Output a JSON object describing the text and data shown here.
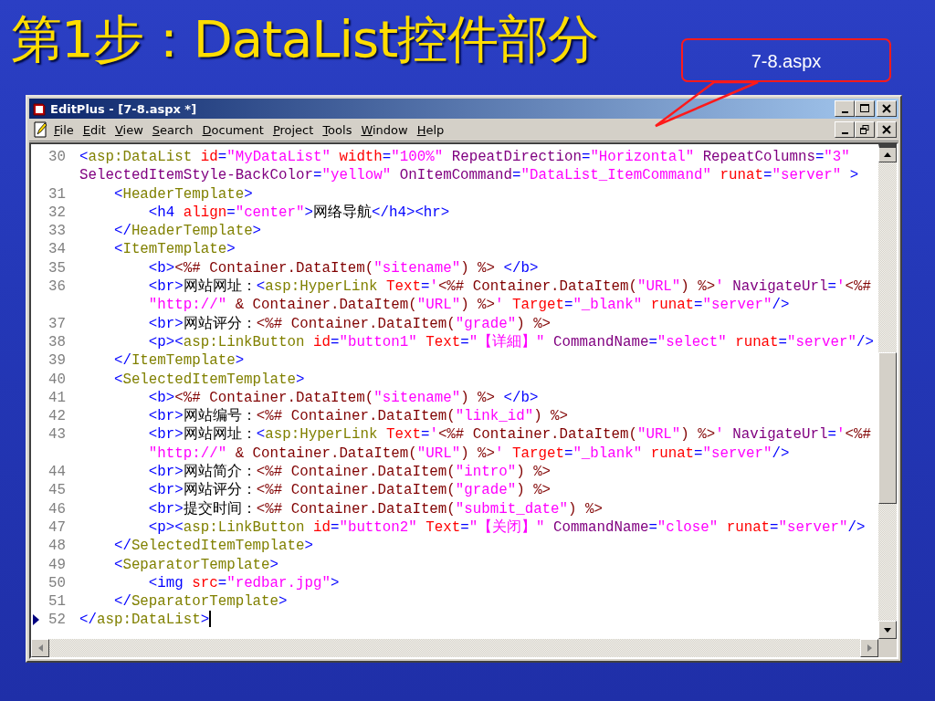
{
  "slide_title": "第1步：DataList控件部分",
  "callout": {
    "text": "7-8.aspx"
  },
  "editor": {
    "title": "EditPlus - [7-8.aspx *]",
    "menu": [
      "File",
      "Edit",
      "View",
      "Search",
      "Document",
      "Project",
      "Tools",
      "Window",
      "Help"
    ],
    "lines": [
      {
        "number": "30",
        "current": false,
        "segments": [
          {
            "kind": "bracket",
            "text": "<"
          },
          {
            "kind": "tag",
            "text": "asp:DataList"
          },
          {
            "kind": "attr",
            "text": " id"
          },
          {
            "kind": "bracket",
            "text": "="
          },
          {
            "kind": "string",
            "text": "\"MyDataList\""
          },
          {
            "kind": "attr",
            "text": " width"
          },
          {
            "kind": "bracket",
            "text": "="
          },
          {
            "kind": "string",
            "text": "\"100%\""
          },
          {
            "kind": "prop",
            "text": " RepeatDirection"
          },
          {
            "kind": "bracket",
            "text": "="
          },
          {
            "kind": "string",
            "text": "\"Horizontal\""
          },
          {
            "kind": "prop",
            "text": " RepeatColumns"
          },
          {
            "kind": "bracket",
            "text": "="
          },
          {
            "kind": "string",
            "text": "\"3\""
          }
        ]
      },
      {
        "current": false,
        "segments": [
          {
            "kind": "prop",
            "text": "SelectedItemStyle-BackColor"
          },
          {
            "kind": "bracket",
            "text": "="
          },
          {
            "kind": "string",
            "text": "\"yellow\""
          },
          {
            "kind": "prop",
            "text": " OnItemCommand"
          },
          {
            "kind": "bracket",
            "text": "="
          },
          {
            "kind": "string",
            "text": "\"DataList_ItemCommand\""
          },
          {
            "kind": "attr",
            "text": " runat"
          },
          {
            "kind": "bracket",
            "text": "="
          },
          {
            "kind": "string",
            "text": "\"server\""
          },
          {
            "kind": "bracket",
            "text": " >"
          }
        ]
      },
      {
        "number": "31",
        "current": false,
        "segments": [
          {
            "kind": "bracket",
            "text": "    <"
          },
          {
            "kind": "tag",
            "text": "HeaderTemplate"
          },
          {
            "kind": "bracket",
            "text": ">"
          }
        ]
      },
      {
        "number": "32",
        "current": false,
        "segments": [
          {
            "kind": "bracket",
            "text": "        <h4"
          },
          {
            "kind": "attr",
            "text": " align"
          },
          {
            "kind": "bracket",
            "text": "="
          },
          {
            "kind": "string",
            "text": "\"center\""
          },
          {
            "kind": "bracket",
            "text": ">"
          },
          {
            "kind": "text",
            "text": "网络导航"
          },
          {
            "kind": "bracket",
            "text": "</h4><hr>"
          }
        ]
      },
      {
        "number": "33",
        "current": false,
        "segments": [
          {
            "kind": "bracket",
            "text": "    </"
          },
          {
            "kind": "tag",
            "text": "HeaderTemplate"
          },
          {
            "kind": "bracket",
            "text": ">"
          }
        ]
      },
      {
        "number": "34",
        "current": false,
        "segments": [
          {
            "kind": "bracket",
            "text": "    <"
          },
          {
            "kind": "tag",
            "text": "ItemTemplate"
          },
          {
            "kind": "bracket",
            "text": ">"
          }
        ]
      },
      {
        "number": "35",
        "current": false,
        "segments": [
          {
            "kind": "bracket",
            "text": "        <b>"
          },
          {
            "kind": "script",
            "text": "<%# Container.DataItem("
          },
          {
            "kind": "string",
            "text": "\"sitename\""
          },
          {
            "kind": "script",
            "text": ") %>"
          },
          {
            "kind": "bracket",
            "text": " </b>"
          }
        ]
      },
      {
        "number": "36",
        "current": false,
        "segments": [
          {
            "kind": "bracket",
            "text": "        <br>"
          },
          {
            "kind": "text",
            "text": "网站网址："
          },
          {
            "kind": "bracket",
            "text": "<"
          },
          {
            "kind": "tag",
            "text": "asp:HyperLink"
          },
          {
            "kind": "attr",
            "text": " Text"
          },
          {
            "kind": "bracket",
            "text": "="
          },
          {
            "kind": "string",
            "text": "'"
          },
          {
            "kind": "script",
            "text": "<%# Container.DataItem("
          },
          {
            "kind": "string",
            "text": "\"URL\""
          },
          {
            "kind": "script",
            "text": ") %>"
          },
          {
            "kind": "string",
            "text": "'"
          },
          {
            "kind": "prop",
            "text": " NavigateUrl"
          },
          {
            "kind": "bracket",
            "text": "="
          },
          {
            "kind": "string",
            "text": "'"
          },
          {
            "kind": "script",
            "text": "<%#"
          }
        ]
      },
      {
        "current": false,
        "segments": [
          {
            "kind": "string",
            "text": "        \"http://\""
          },
          {
            "kind": "script",
            "text": " & Container.DataItem("
          },
          {
            "kind": "string",
            "text": "\"URL\""
          },
          {
            "kind": "script",
            "text": ") %>"
          },
          {
            "kind": "string",
            "text": "'"
          },
          {
            "kind": "attr",
            "text": " Target"
          },
          {
            "kind": "bracket",
            "text": "="
          },
          {
            "kind": "string",
            "text": "\"_blank\""
          },
          {
            "kind": "attr",
            "text": " runat"
          },
          {
            "kind": "bracket",
            "text": "="
          },
          {
            "kind": "string",
            "text": "\"server\""
          },
          {
            "kind": "bracket",
            "text": "/>"
          }
        ]
      },
      {
        "number": "37",
        "current": false,
        "segments": [
          {
            "kind": "bracket",
            "text": "        <br>"
          },
          {
            "kind": "text",
            "text": "网站评分："
          },
          {
            "kind": "script",
            "text": "<%# Container.DataItem("
          },
          {
            "kind": "string",
            "text": "\"grade\""
          },
          {
            "kind": "script",
            "text": ") %>"
          }
        ]
      },
      {
        "number": "38",
        "current": false,
        "segments": [
          {
            "kind": "bracket",
            "text": "        <p><"
          },
          {
            "kind": "tag",
            "text": "asp:LinkButton"
          },
          {
            "kind": "attr",
            "text": " id"
          },
          {
            "kind": "bracket",
            "text": "="
          },
          {
            "kind": "string",
            "text": "\"button1\""
          },
          {
            "kind": "attr",
            "text": " Text"
          },
          {
            "kind": "bracket",
            "text": "="
          },
          {
            "kind": "string",
            "text": "\"【详細】\""
          },
          {
            "kind": "prop",
            "text": " CommandName"
          },
          {
            "kind": "bracket",
            "text": "="
          },
          {
            "kind": "string",
            "text": "\"select\""
          },
          {
            "kind": "attr",
            "text": " runat"
          },
          {
            "kind": "bracket",
            "text": "="
          },
          {
            "kind": "string",
            "text": "\"server\""
          },
          {
            "kind": "bracket",
            "text": "/>"
          }
        ]
      },
      {
        "number": "39",
        "current": false,
        "segments": [
          {
            "kind": "bracket",
            "text": "    </"
          },
          {
            "kind": "tag",
            "text": "ItemTemplate"
          },
          {
            "kind": "bracket",
            "text": ">"
          }
        ]
      },
      {
        "number": "40",
        "current": false,
        "segments": [
          {
            "kind": "bracket",
            "text": "    <"
          },
          {
            "kind": "tag",
            "text": "SelectedItemTemplate"
          },
          {
            "kind": "bracket",
            "text": ">"
          }
        ]
      },
      {
        "number": "41",
        "current": false,
        "segments": [
          {
            "kind": "bracket",
            "text": "        <b>"
          },
          {
            "kind": "script",
            "text": "<%# Container.DataItem("
          },
          {
            "kind": "string",
            "text": "\"sitename\""
          },
          {
            "kind": "script",
            "text": ") %>"
          },
          {
            "kind": "bracket",
            "text": " </b>"
          }
        ]
      },
      {
        "number": "42",
        "current": false,
        "segments": [
          {
            "kind": "bracket",
            "text": "        <br>"
          },
          {
            "kind": "text",
            "text": "网站编号："
          },
          {
            "kind": "script",
            "text": "<%# Container.DataItem("
          },
          {
            "kind": "string",
            "text": "\"link_id\""
          },
          {
            "kind": "script",
            "text": ") %>"
          }
        ]
      },
      {
        "number": "43",
        "current": false,
        "segments": [
          {
            "kind": "bracket",
            "text": "        <br>"
          },
          {
            "kind": "text",
            "text": "网站网址："
          },
          {
            "kind": "bracket",
            "text": "<"
          },
          {
            "kind": "tag",
            "text": "asp:HyperLink"
          },
          {
            "kind": "attr",
            "text": " Text"
          },
          {
            "kind": "bracket",
            "text": "="
          },
          {
            "kind": "string",
            "text": "'"
          },
          {
            "kind": "script",
            "text": "<%# Container.DataItem("
          },
          {
            "kind": "string",
            "text": "\"URL\""
          },
          {
            "kind": "script",
            "text": ") %>"
          },
          {
            "kind": "string",
            "text": "'"
          },
          {
            "kind": "prop",
            "text": " NavigateUrl"
          },
          {
            "kind": "bracket",
            "text": "="
          },
          {
            "kind": "string",
            "text": "'"
          },
          {
            "kind": "script",
            "text": "<%#"
          }
        ]
      },
      {
        "current": false,
        "segments": [
          {
            "kind": "string",
            "text": "        \"http://\""
          },
          {
            "kind": "script",
            "text": " & Container.DataItem("
          },
          {
            "kind": "string",
            "text": "\"URL\""
          },
          {
            "kind": "script",
            "text": ") %>"
          },
          {
            "kind": "string",
            "text": "'"
          },
          {
            "kind": "attr",
            "text": " Target"
          },
          {
            "kind": "bracket",
            "text": "="
          },
          {
            "kind": "string",
            "text": "\"_blank\""
          },
          {
            "kind": "attr",
            "text": " runat"
          },
          {
            "kind": "bracket",
            "text": "="
          },
          {
            "kind": "string",
            "text": "\"server\""
          },
          {
            "kind": "bracket",
            "text": "/>"
          }
        ]
      },
      {
        "number": "44",
        "current": false,
        "segments": [
          {
            "kind": "bracket",
            "text": "        <br>"
          },
          {
            "kind": "text",
            "text": "网站简介："
          },
          {
            "kind": "script",
            "text": "<%# Container.DataItem("
          },
          {
            "kind": "string",
            "text": "\"intro\""
          },
          {
            "kind": "script",
            "text": ") %>"
          }
        ]
      },
      {
        "number": "45",
        "current": false,
        "segments": [
          {
            "kind": "bracket",
            "text": "        <br>"
          },
          {
            "kind": "text",
            "text": "网站评分："
          },
          {
            "kind": "script",
            "text": "<%# Container.DataItem("
          },
          {
            "kind": "string",
            "text": "\"grade\""
          },
          {
            "kind": "script",
            "text": ") %>"
          }
        ]
      },
      {
        "number": "46",
        "current": false,
        "segments": [
          {
            "kind": "bracket",
            "text": "        <br>"
          },
          {
            "kind": "text",
            "text": "提交时间："
          },
          {
            "kind": "script",
            "text": "<%# Container.DataItem("
          },
          {
            "kind": "string",
            "text": "\"submit_date\""
          },
          {
            "kind": "script",
            "text": ") %>"
          }
        ]
      },
      {
        "number": "47",
        "current": false,
        "segments": [
          {
            "kind": "bracket",
            "text": "        <p><"
          },
          {
            "kind": "tag",
            "text": "asp:LinkButton"
          },
          {
            "kind": "attr",
            "text": " id"
          },
          {
            "kind": "bracket",
            "text": "="
          },
          {
            "kind": "string",
            "text": "\"button2\""
          },
          {
            "kind": "attr",
            "text": " Text"
          },
          {
            "kind": "bracket",
            "text": "="
          },
          {
            "kind": "string",
            "text": "\"【关闭】\""
          },
          {
            "kind": "prop",
            "text": " CommandName"
          },
          {
            "kind": "bracket",
            "text": "="
          },
          {
            "kind": "string",
            "text": "\"close\""
          },
          {
            "kind": "attr",
            "text": " runat"
          },
          {
            "kind": "bracket",
            "text": "="
          },
          {
            "kind": "string",
            "text": "\"server\""
          },
          {
            "kind": "bracket",
            "text": "/>"
          }
        ]
      },
      {
        "number": "48",
        "current": false,
        "segments": [
          {
            "kind": "bracket",
            "text": "    </"
          },
          {
            "kind": "tag",
            "text": "SelectedItemTemplate"
          },
          {
            "kind": "bracket",
            "text": ">"
          }
        ]
      },
      {
        "number": "49",
        "current": false,
        "segments": [
          {
            "kind": "bracket",
            "text": "    <"
          },
          {
            "kind": "tag",
            "text": "SeparatorTemplate"
          },
          {
            "kind": "bracket",
            "text": ">"
          }
        ]
      },
      {
        "number": "50",
        "current": false,
        "segments": [
          {
            "kind": "bracket",
            "text": "        <img"
          },
          {
            "kind": "attr",
            "text": " src"
          },
          {
            "kind": "bracket",
            "text": "="
          },
          {
            "kind": "string",
            "text": "\"redbar.jpg\""
          },
          {
            "kind": "bracket",
            "text": ">"
          }
        ]
      },
      {
        "number": "51",
        "current": false,
        "segments": [
          {
            "kind": "bracket",
            "text": "    </"
          },
          {
            "kind": "tag",
            "text": "SeparatorTemplate"
          },
          {
            "kind": "bracket",
            "text": ">"
          }
        ]
      },
      {
        "number": "52",
        "current": true,
        "segments": [
          {
            "kind": "bracket",
            "text": "</"
          },
          {
            "kind": "tag",
            "text": "asp:DataList"
          },
          {
            "kind": "bracket",
            "text": ">"
          }
        ]
      }
    ]
  }
}
